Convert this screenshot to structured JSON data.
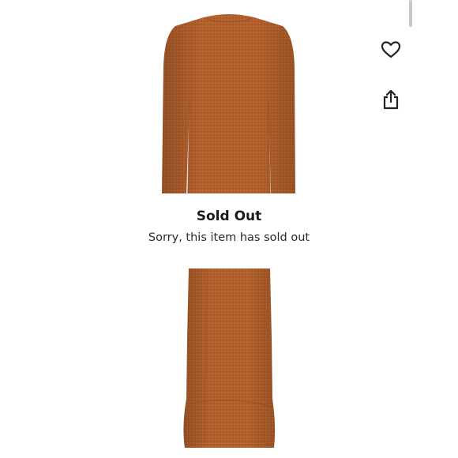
{
  "product": {
    "image_desc_icon": "dress-photo",
    "fabric_color": "#b5642e"
  },
  "status": {
    "title": "Sold Out",
    "message": "Sorry, this item has sold out"
  },
  "actions": {
    "like_icon": "heart-icon",
    "share_icon": "share-icon"
  }
}
